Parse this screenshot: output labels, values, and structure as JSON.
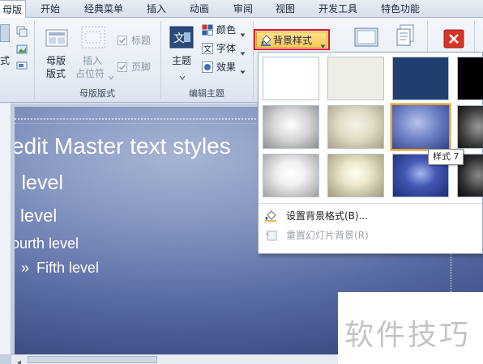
{
  "tabs": [
    "母版",
    "开始",
    "经典菜单",
    "插入",
    "动画",
    "审阅",
    "视图",
    "开发工具",
    "特色功能"
  ],
  "ribbon": {
    "partial_left_label": "式",
    "master_layout": {
      "group_label": "母版版式",
      "master_layout_btn": [
        "母版",
        "版式"
      ],
      "insert_placeholder_btn": [
        "插入",
        "占位符"
      ],
      "title_check": "标题",
      "footer_check": "页脚"
    },
    "edit_theme": {
      "group_label": "编辑主题",
      "theme_btn": "主题",
      "colors": "颜色",
      "fonts": "字体",
      "effects": "效果"
    },
    "background_styles_btn": "背景样式"
  },
  "slide": {
    "level1": "edit Master text styles",
    "level2": "l level",
    "level3": "l level",
    "level4": "ourth level",
    "level5_bullet": "»",
    "level5": "Fifth level"
  },
  "gallery": {
    "swatch_colors": [
      [
        "#ffffff",
        "#eeeee6",
        "#203f6f",
        "#000000"
      ],
      [
        "gray-gradient",
        "cream-gradient",
        "blue-gradient",
        "dark-gradient"
      ],
      [
        "white-radial",
        "cream-radial",
        "blue-radial",
        "dark-radial"
      ]
    ],
    "selected_style": "样式 7",
    "menu": {
      "format_background": "设置背景格式(B)...",
      "reset_background": "重置幻灯片背景(R)"
    }
  },
  "tooltip": "样式 7",
  "watermark": "软件技巧",
  "colors": {
    "highlight_border": "#e2141b",
    "selected_swatch": "#e6a23c",
    "slide_dark": "#38467d"
  }
}
